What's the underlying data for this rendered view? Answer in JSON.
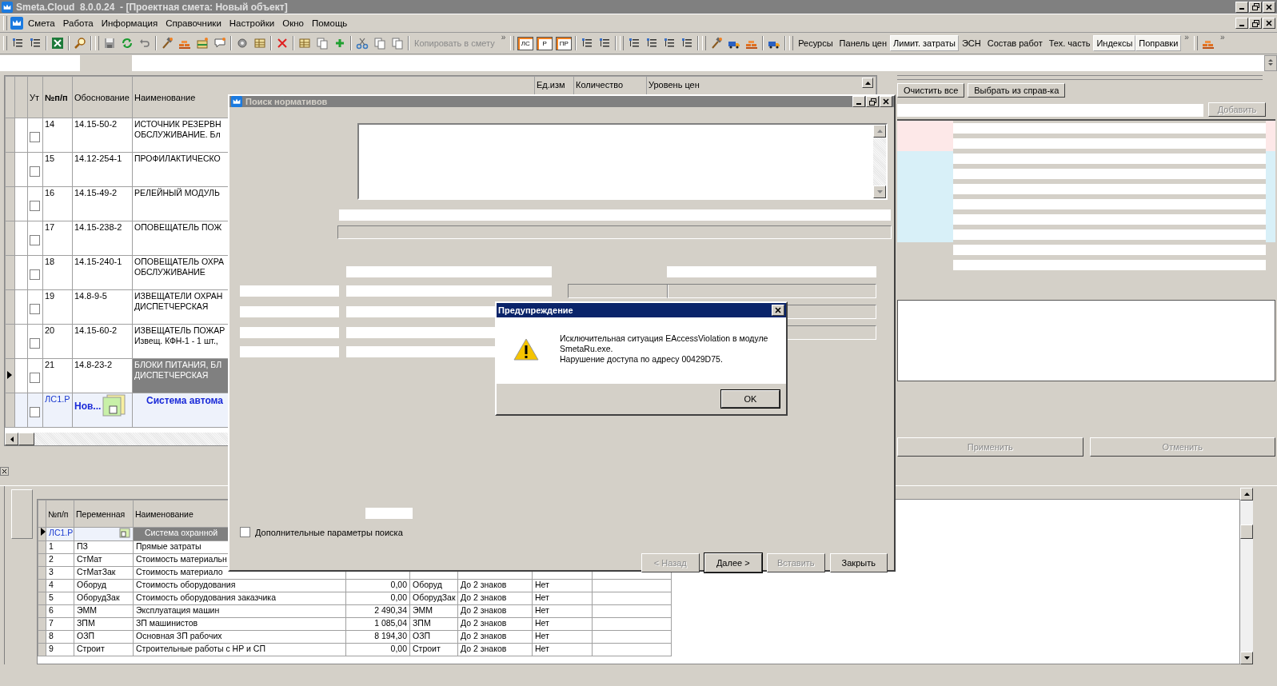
{
  "app": {
    "title": "Smeta.Cloud  8.0.0.24  - [Проектная смета: Новый объект]"
  },
  "menu": [
    "Смета",
    "Работа",
    "Информация",
    "Справочники",
    "Настройки",
    "Окно",
    "Помощь"
  ],
  "toolbar": {
    "doc_buttons": [
      "ЛС",
      "Р",
      "ПР"
    ],
    "copy_label": "Копировать в смету",
    "overflow_marks": [
      "»",
      "»",
      "»"
    ],
    "tabs": [
      {
        "label": "Ресурсы",
        "selected": false
      },
      {
        "label": "Панель цен",
        "selected": false
      },
      {
        "label": "Лимит. затраты",
        "selected": true
      },
      {
        "label": "ЭСН",
        "selected": false
      },
      {
        "label": "Состав работ",
        "selected": false
      },
      {
        "label": "Тех. часть",
        "selected": false
      },
      {
        "label": "Индексы",
        "selected": true
      },
      {
        "label": "Поправки",
        "selected": true
      }
    ]
  },
  "main_table": {
    "columns": [
      "Ут",
      "№п/п",
      "Обоснование",
      "Наименование",
      "Ед.изм",
      "Количество",
      "Уровень цен"
    ],
    "rows": [
      {
        "kind": "item",
        "number": "14",
        "code": "14.15-50-2",
        "name": [
          "ИСТОЧНИК РЕЗЕРВН",
          "ОБСЛУЖИВАНИЕ. Бл"
        ],
        "checked": false,
        "selected": false
      },
      {
        "kind": "item",
        "number": "15",
        "code": "14.12-254-1",
        "name": [
          "ПРОФИЛАКТИЧЕСКО"
        ],
        "checked": false,
        "selected": false
      },
      {
        "kind": "item",
        "number": "16",
        "code": "14.15-49-2",
        "name": [
          "РЕЛЕЙНЫЙ МОДУЛЬ"
        ],
        "checked": false,
        "selected": false
      },
      {
        "kind": "item",
        "number": "17",
        "code": "14.15-238-2",
        "name": [
          "ОПОВЕЩАТЕЛЬ ПОЖ"
        ],
        "checked": false,
        "selected": false
      },
      {
        "kind": "item",
        "number": "18",
        "code": "14.15-240-1",
        "name": [
          "ОПОВЕЩАТЕЛЬ ОХРА",
          "ОБСЛУЖИВАНИЕ"
        ],
        "checked": false,
        "selected": false
      },
      {
        "kind": "item",
        "number": "19",
        "code": "14.8-9-5",
        "name": [
          "ИЗВЕЩАТЕЛИ ОХРАН",
          "ДИСПЕТЧЕРСКАЯ"
        ],
        "checked": false,
        "selected": false
      },
      {
        "kind": "item",
        "number": "20",
        "code": "14.15-60-2",
        "name": [
          "ИЗВЕЩАТЕЛЬ ПОЖАР",
          "Извещ. КФН-1 - 1 шт.,"
        ],
        "checked": false,
        "selected": false
      },
      {
        "kind": "item",
        "number": "21",
        "code": "14.8-23-2",
        "name": [
          "БЛОКИ ПИТАНИЯ, БЛ",
          "ДИСПЕТЧЕРСКАЯ"
        ],
        "checked": false,
        "selected": true
      },
      {
        "kind": "section",
        "number": "ЛС1.Р",
        "code": "Нов...",
        "name": [
          "Система автома"
        ],
        "checked": false,
        "selected": false
      }
    ]
  },
  "right_panel": {
    "buttons": [
      "Очистить все",
      "Выбрать из справ-ка"
    ],
    "add_button": {
      "label": "Добавить",
      "disabled": true
    },
    "grid_rows": [
      {
        "color": "#fde8e8"
      },
      {
        "color": "#fde8e8"
      },
      {
        "color": "#d8f0f8"
      },
      {
        "color": "#d8f0f8"
      },
      {
        "color": "#d8f0f8"
      },
      {
        "color": "#d8f0f8"
      },
      {
        "color": "#d8f0f8"
      },
      {
        "color": "#d8f0f8"
      }
    ],
    "action_buttons": [
      {
        "label": "Применить",
        "disabled": true
      },
      {
        "label": "Отменить",
        "disabled": true
      }
    ]
  },
  "bottom_table": {
    "columns": [
      "№п/п",
      "Переменная",
      "Наименование"
    ],
    "rows": [
      {
        "kind": "section",
        "number": "ЛС1.Р",
        "name": "Система охранной",
        "selected": true
      },
      {
        "kind": "item",
        "number": "1",
        "variable": "ПЗ",
        "name": "Прямые затраты",
        "selected": false
      },
      {
        "kind": "item",
        "number": "2",
        "variable": "СтМат",
        "name": "Стоимость материальн",
        "selected": false
      },
      {
        "kind": "item",
        "number": "3",
        "variable": "СтМатЗак",
        "name": "Стоимость материало",
        "selected": false
      },
      {
        "kind": "item",
        "number": "4",
        "variable": "Оборуд",
        "name": "Стоимость оборудования",
        "value": "0,00",
        "code": "Оборуд",
        "rounding": "До 2 знаков",
        "flag": "Нет",
        "selected": false
      },
      {
        "kind": "item",
        "number": "5",
        "variable": "ОборудЗак",
        "name": "Стоимость оборудования заказчика",
        "value": "0,00",
        "code": "ОборудЗак",
        "rounding": "До 2 знаков",
        "flag": "Нет",
        "selected": false
      },
      {
        "kind": "item",
        "number": "6",
        "variable": "ЭММ",
        "name": "Эксплуатация машин",
        "value": "2 490,34",
        "code": "ЭММ",
        "rounding": "До 2 знаков",
        "flag": "Нет",
        "selected": false
      },
      {
        "kind": "item",
        "number": "7",
        "variable": "ЗПМ",
        "name": "ЗП машинистов",
        "value": "1 085,04",
        "code": "ЗПМ",
        "rounding": "До 2 знаков",
        "flag": "Нет",
        "selected": false
      },
      {
        "kind": "item",
        "number": "8",
        "variable": "ОЗП",
        "name": "Основная ЗП рабочих",
        "value": "8 194,30",
        "code": "ОЗП",
        "rounding": "До 2 знаков",
        "flag": "Нет",
        "selected": false
      },
      {
        "kind": "item",
        "number": "9",
        "variable": "Строит",
        "name": "Строительные работы с НР и СП",
        "value": "0,00",
        "code": "Строит",
        "rounding": "До 2 знаков",
        "flag": "Нет",
        "selected": false
      }
    ]
  },
  "search_dialog": {
    "title": "Поиск нормативов",
    "extra_params": {
      "label": "Дополнительные параметры поиска",
      "checked": false
    },
    "buttons": [
      {
        "label": "< Назад",
        "disabled": true,
        "default": false
      },
      {
        "label": "Далее >",
        "disabled": false,
        "default": true
      },
      {
        "label": "Вставить",
        "disabled": true,
        "default": false
      },
      {
        "label": "Закрыть",
        "disabled": false,
        "default": false
      }
    ]
  },
  "warning": {
    "title": "Предупреждение",
    "message": "Исключительная ситуация EAccessViolation в модуле\nSmetaRu.exe.\nНарушение доступа по адресу 00429D75.",
    "button": "OK"
  }
}
